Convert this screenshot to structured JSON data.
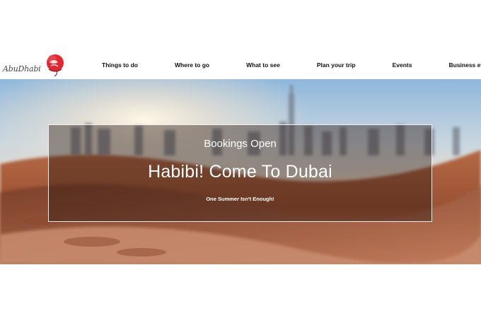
{
  "brand": {
    "logo_text": "AbuDhabi",
    "accent_color": "#e3262f"
  },
  "nav": {
    "items": [
      {
        "label": "Things to do"
      },
      {
        "label": "Where to go"
      },
      {
        "label": "What to see"
      },
      {
        "label": "Plan your trip"
      },
      {
        "label": "Events"
      },
      {
        "label": "Business events"
      }
    ]
  },
  "hero": {
    "kicker": "Bookings Open",
    "title": "Habibi! Come To Dubai",
    "subtitle": "One Summer Isn't Enough!",
    "background": "desert-city-skyline-image"
  }
}
